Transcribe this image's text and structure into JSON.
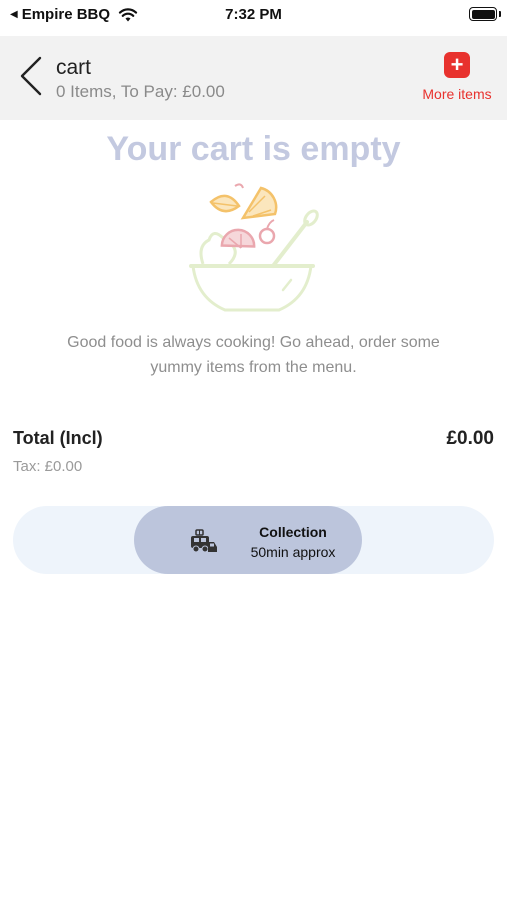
{
  "status_bar": {
    "back_app": "Empire BBQ",
    "time": "7:32 PM"
  },
  "header": {
    "title": "cart",
    "subtitle": "0 Items, To Pay: £0.00",
    "more_items_label": "More items",
    "accent_color": "#e8322e"
  },
  "empty_state": {
    "title": "Your cart is empty",
    "message": "Good food is always cooking! Go ahead, order some yummy items from the menu."
  },
  "totals": {
    "total_label": "Total (Incl)",
    "total_value": "£0.00",
    "tax": "Tax: £0.00"
  },
  "order_mode": {
    "title": "Collection",
    "subtitle": "50min approx",
    "icon": "collection-vehicle-icon"
  }
}
